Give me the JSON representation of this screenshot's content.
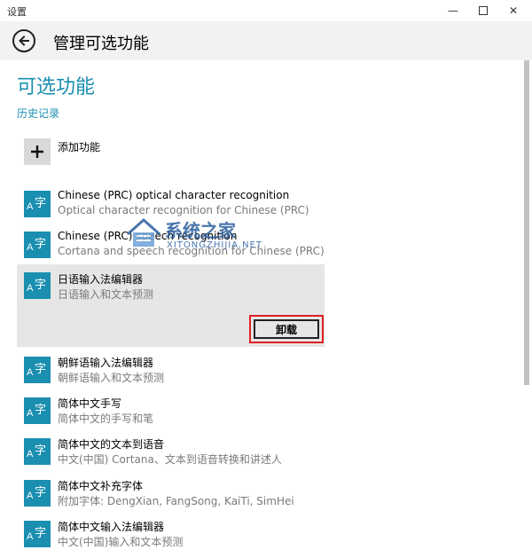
{
  "window": {
    "title": "设置",
    "minimize_glyph": "—",
    "close_glyph": "✕"
  },
  "header": {
    "title": "管理可选功能"
  },
  "section": {
    "title": "可选功能",
    "history_link": "历史记录"
  },
  "add_feature": {
    "label": "添加功能",
    "icon": "plus-icon"
  },
  "feature_icon": {
    "a": "A",
    "zi": "字",
    "color": "#1a8fb0"
  },
  "features": [
    {
      "name": "Chinese (PRC) optical character recognition",
      "desc": "Optical character recognition for Chinese (PRC)"
    },
    {
      "name": "Chinese (PRC) speech recognition",
      "desc": "Cortana and speech recognition for Chinese (PRC)"
    },
    {
      "name": "日语输入法编辑器",
      "desc": "日语输入和文本预测",
      "selected": true
    },
    {
      "name": "朝鲜语输入法编辑器",
      "desc": "朝鲜语输入和文本预测"
    },
    {
      "name": "简体中文手写",
      "desc": "简体中文的手写和笔"
    },
    {
      "name": "简体中文的文本到语音",
      "desc": "中文(中国) Cortana、文本到语音转换和讲述人"
    },
    {
      "name": "简体中文补充字体",
      "desc": "附加字体: DengXian, FangSong, KaiTi, SimHei"
    },
    {
      "name": "简体中文输入法编辑器",
      "desc": "中文(中国)输入和文本预测"
    }
  ],
  "uninstall_button": {
    "label": "卸载",
    "highlight_color": "#e02020"
  },
  "watermark": {
    "title": "系统之家",
    "subtitle": "XITONGZHIJIA.NET"
  },
  "colors": {
    "accent": "#1a8fb0",
    "header_bg": "#f2f2f2",
    "selected_bg": "#e6e6e6"
  }
}
